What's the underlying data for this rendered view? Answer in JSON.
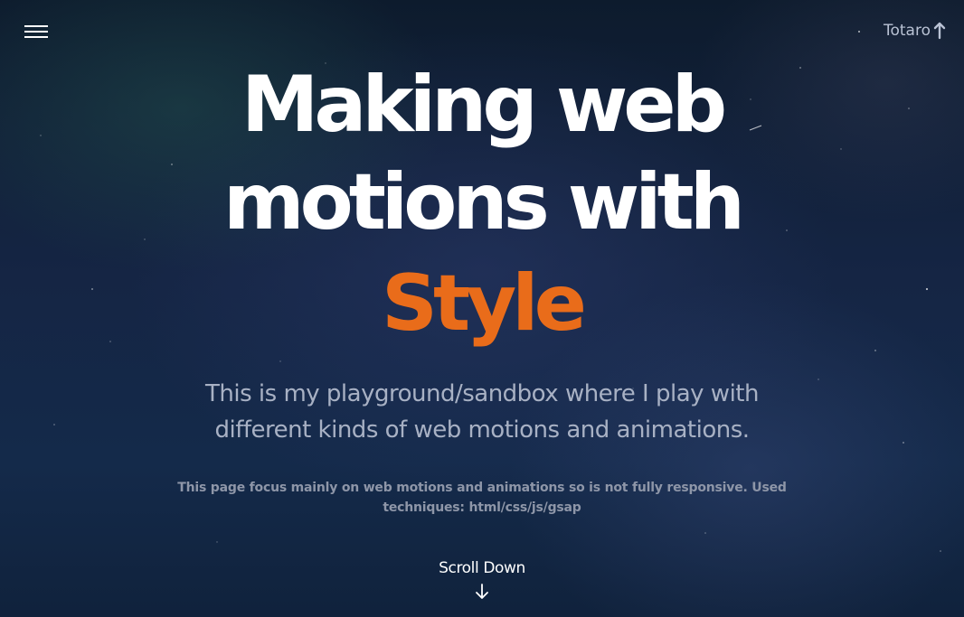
{
  "header": {
    "menu_icon": "hamburger-menu-icon",
    "brand_label": "Totaro",
    "brand_icon": "arrow-up-icon"
  },
  "hero": {
    "headline_line1": "Making web",
    "headline_line2": "motions with",
    "headline_accent": "Style",
    "subtitle": "This is my playground/sandbox where I play with different kinds of web motions and animations.",
    "note": "This page focus mainly on web motions and animations so is not fully responsive. Used techniques: html/css/js/gsap",
    "scroll_label": "Scroll Down",
    "scroll_icon": "arrow-down-icon"
  },
  "colors": {
    "accent": "#e96c1a",
    "background": "#152544",
    "subtitle": "#a8b1c4",
    "note": "#8e96a8"
  }
}
